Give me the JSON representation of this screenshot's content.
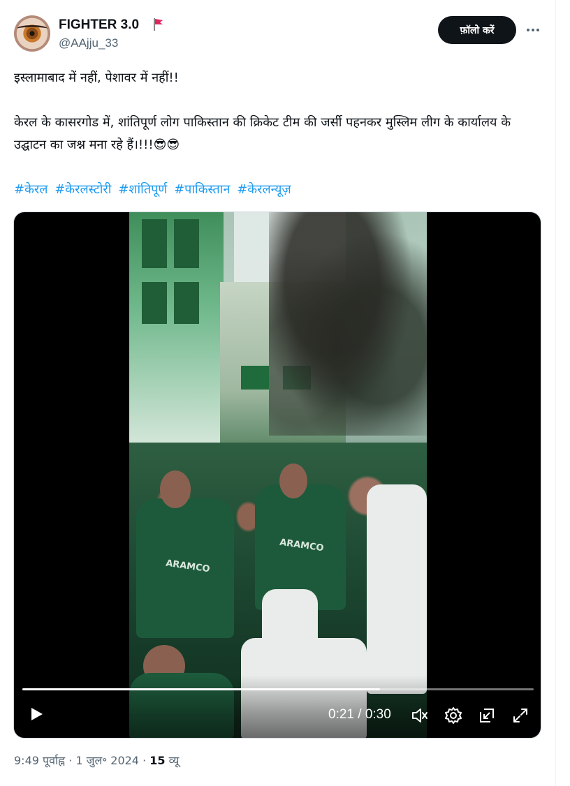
{
  "author": {
    "name": "FIGHTER 3.0",
    "handle": "@AAjju_33",
    "badge_icon": "red-flag-icon",
    "follow_label": "फ़ॉलो करें"
  },
  "tweet": {
    "line1": "इस्लामाबाद में नहीं, पेशावर में नहीं!!",
    "line2": "केरल के कासरगोड में, शांतिपूर्ण लोग पाकिस्तान की क्रिकेट टीम की जर्सी पहनकर मुस्लिम लीग के कार्यालय के उद्घाटन का जश्न मना रहे हैं।!!!😎😎",
    "hashtags": [
      "#केरल",
      "#केरलस्टोरी",
      "#शांतिपूर्ण",
      "#पाकिस्तान",
      "#केरलन्यूज़"
    ]
  },
  "video": {
    "current_time": "0:21",
    "duration": "0:30",
    "time_display": "0:21 / 0:30",
    "progress_fraction": 0.7,
    "controls": [
      "play-icon",
      "volume-icon",
      "settings-gear-icon",
      "picture-in-picture-icon",
      "fullscreen-icon"
    ]
  },
  "meta": {
    "time": "9:49 पूर्वाह्न",
    "date": "1 जुल॰ 2024",
    "views_count": "15",
    "views_label": "व्यू"
  },
  "colors": {
    "link": "#1d9bf0",
    "text": "#0f1419",
    "muted": "#536471",
    "button_bg": "#0f1419"
  }
}
